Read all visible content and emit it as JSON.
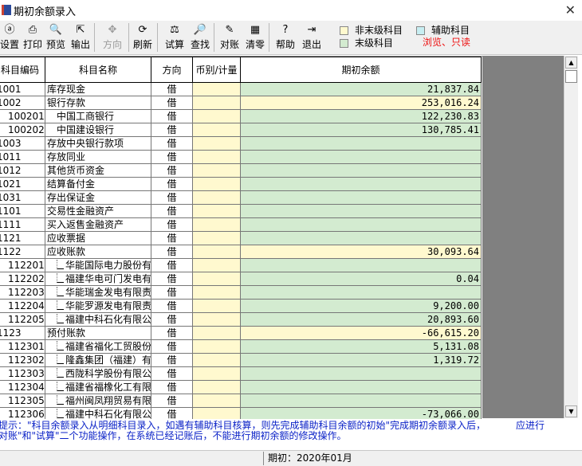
{
  "window": {
    "title": "期初余额录入",
    "close_label": "✕"
  },
  "toolbar": [
    {
      "label": "设置",
      "icon": "ⓐ",
      "icon_name": "settings-icon",
      "enabled": true
    },
    {
      "label": "打印",
      "icon": "⎙",
      "icon_name": "printer-icon",
      "enabled": true
    },
    {
      "label": "预览",
      "icon": "🔍",
      "icon_name": "preview-icon",
      "enabled": true
    },
    {
      "label": "输出",
      "icon": "⇱",
      "icon_name": "export-icon",
      "enabled": true
    },
    {
      "label": "方向",
      "icon": "✥",
      "icon_name": "direction-icon",
      "enabled": false
    },
    {
      "label": "刷新",
      "icon": "⟳",
      "icon_name": "refresh-icon",
      "enabled": true
    },
    {
      "label": "试算",
      "icon": "⚖",
      "icon_name": "balance-icon",
      "enabled": true
    },
    {
      "label": "查找",
      "icon": "🔎",
      "icon_name": "find-icon",
      "enabled": true
    },
    {
      "label": "对账",
      "icon": "✎",
      "icon_name": "reconcile-icon",
      "enabled": true
    },
    {
      "label": "清零",
      "icon": "▦",
      "icon_name": "clear-zero-icon",
      "enabled": true
    },
    {
      "label": "帮助",
      "icon": "?",
      "icon_name": "help-icon",
      "enabled": true
    },
    {
      "label": "退出",
      "icon": "⇥",
      "icon_name": "exit-icon",
      "enabled": true
    }
  ],
  "legend": {
    "non_leaf": "非末级科目",
    "aux": "辅助科目",
    "leaf": "末级科目",
    "mode": "浏览、只读",
    "colors": {
      "non_leaf": "#fff9cf",
      "aux": "#c7eef2",
      "leaf": "#d3ebd0"
    }
  },
  "columns": [
    "科目编码",
    "科目名称",
    "方向",
    "币别/计量",
    "期初余额"
  ],
  "rows": [
    {
      "code": "1001",
      "name": "库存现金",
      "dir": "借",
      "amount": "21,837.84",
      "level": 1,
      "leaf": true,
      "aux": false
    },
    {
      "code": "1002",
      "name": "银行存款",
      "dir": "借",
      "amount": "253,016.24",
      "level": 1,
      "leaf": false,
      "aux": false
    },
    {
      "code": "100201",
      "name": "中国工商银行",
      "dir": "借",
      "amount": "122,230.83",
      "level": 2,
      "leaf": true,
      "aux": false
    },
    {
      "code": "100202",
      "name": "中国建设银行",
      "dir": "借",
      "amount": "130,785.41",
      "level": 2,
      "leaf": true,
      "aux": false
    },
    {
      "code": "1003",
      "name": "存放中央银行款项",
      "dir": "借",
      "amount": "",
      "level": 1,
      "leaf": true,
      "aux": false
    },
    {
      "code": "1011",
      "name": "存放同业",
      "dir": "借",
      "amount": "",
      "level": 1,
      "leaf": true,
      "aux": false
    },
    {
      "code": "1012",
      "name": "其他货币资金",
      "dir": "借",
      "amount": "",
      "level": 1,
      "leaf": true,
      "aux": false
    },
    {
      "code": "1021",
      "name": "结算备付金",
      "dir": "借",
      "amount": "",
      "level": 1,
      "leaf": true,
      "aux": false
    },
    {
      "code": "1031",
      "name": "存出保证金",
      "dir": "借",
      "amount": "",
      "level": 1,
      "leaf": true,
      "aux": false
    },
    {
      "code": "1101",
      "name": "交易性金融资产",
      "dir": "借",
      "amount": "",
      "level": 1,
      "leaf": true,
      "aux": false
    },
    {
      "code": "1111",
      "name": "买入返售金融资产",
      "dir": "借",
      "amount": "",
      "level": 1,
      "leaf": true,
      "aux": false
    },
    {
      "code": "1121",
      "name": "应收票据",
      "dir": "借",
      "amount": "",
      "level": 1,
      "leaf": true,
      "aux": false
    },
    {
      "code": "1122",
      "name": "应收账款",
      "dir": "借",
      "amount": "30,093.64",
      "level": 1,
      "leaf": false,
      "aux": false
    },
    {
      "code": "112201",
      "name": "华能国际电力股份有",
      "dir": "借",
      "amount": "",
      "level": 2,
      "leaf": true,
      "aux": true
    },
    {
      "code": "112202",
      "name": "福建华电可门发电有",
      "dir": "借",
      "amount": "0.04",
      "level": 2,
      "leaf": true,
      "aux": true
    },
    {
      "code": "112203",
      "name": "华能瑞金发电有限责",
      "dir": "借",
      "amount": "",
      "level": 2,
      "leaf": true,
      "aux": true
    },
    {
      "code": "112204",
      "name": "华能罗源发电有限责",
      "dir": "借",
      "amount": "9,200.00",
      "level": 2,
      "leaf": true,
      "aux": true
    },
    {
      "code": "112205",
      "name": "福建中科石化有限公",
      "dir": "借",
      "amount": "20,893.60",
      "level": 2,
      "leaf": true,
      "aux": true
    },
    {
      "code": "1123",
      "name": "预付账款",
      "dir": "借",
      "amount": "-66,615.20",
      "level": 1,
      "leaf": false,
      "aux": false
    },
    {
      "code": "112301",
      "name": "福建省福化工贸股份",
      "dir": "借",
      "amount": "5,131.08",
      "level": 2,
      "leaf": true,
      "aux": true
    },
    {
      "code": "112302",
      "name": "隆鑫集团（福建）有",
      "dir": "借",
      "amount": "1,319.72",
      "level": 2,
      "leaf": true,
      "aux": true
    },
    {
      "code": "112303",
      "name": "西陇科学股份有限公",
      "dir": "借",
      "amount": "",
      "level": 2,
      "leaf": true,
      "aux": true
    },
    {
      "code": "112304",
      "name": "福建省福橡化工有限",
      "dir": "借",
      "amount": "",
      "level": 2,
      "leaf": true,
      "aux": true
    },
    {
      "code": "112305",
      "name": "福州闽凤翔贸易有限",
      "dir": "借",
      "amount": "",
      "level": 2,
      "leaf": true,
      "aux": true
    },
    {
      "code": "112306",
      "name": "福建中科石化有限公",
      "dir": "借",
      "amount": "-73,066.00",
      "level": 2,
      "leaf": true,
      "aux": true
    }
  ],
  "hint": {
    "line1": "提示：\"科目余额录入从明细科目录入，如遇有辅助科目核算，则先完成辅助科目余额的初始\"完成期初余额录入后，",
    "line1_tail": "应进行",
    "line2": "对账\"和\"试算\"二个功能操作，在系统已经记账后，不能进行期初余额的修改操作。"
  },
  "status": {
    "period": "期初：2020年01月"
  }
}
